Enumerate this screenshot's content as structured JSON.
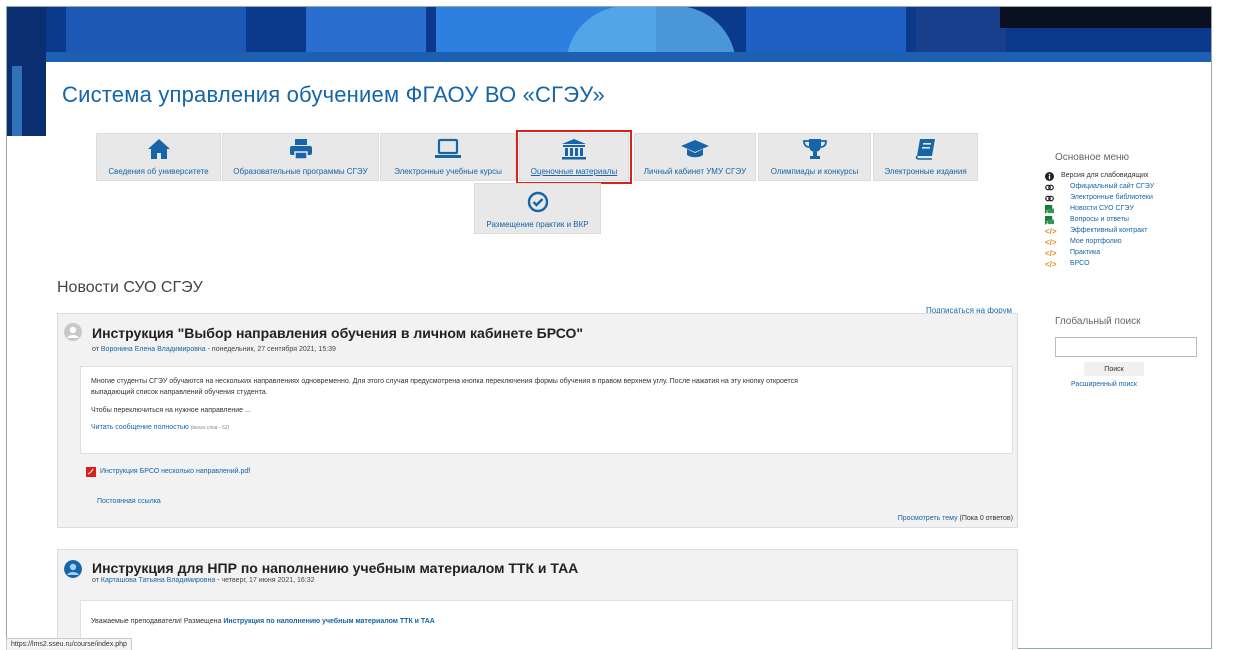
{
  "site_title": "Система управления обучением ФГАОУ ВО «СГЭУ»",
  "nav_tiles": [
    {
      "label": "Сведения об университете",
      "icon": "home-icon"
    },
    {
      "label": "Образовательные программы СГЭУ",
      "icon": "printer-icon"
    },
    {
      "label": "Электронные учебные курсы",
      "icon": "laptop-icon"
    },
    {
      "label": "Оценочные материалы",
      "icon": "university-icon",
      "active": true
    },
    {
      "label": "Личный кабинет УМУ СГЭУ",
      "icon": "graduation-cap-icon"
    },
    {
      "label": "Олимпиады и конкурсы",
      "icon": "trophy-icon"
    },
    {
      "label": "Электронные издания",
      "icon": "book-icon"
    },
    {
      "label": "Размещение практик и ВКР",
      "icon": "check-circle-icon"
    }
  ],
  "news": {
    "heading": "Новости СУО СГЭУ",
    "subscribe_label": "Подписаться на форум",
    "posts": [
      {
        "title": "Инструкция \"Выбор направления обучения в личном кабинете БРСО\"",
        "meta_prefix": "от ",
        "author": "Воронина Елена Владимировна",
        "date": " - понедельник, 27 сентября 2021, 15:39",
        "body_line1": "Многие студенты СГЭУ обучаются на нескольких направлениях одновременно. Для этого случая предусмотрена кнопка переключения формы обучения  в правом верхнем углу. После нажатия на эту кнопку откроется",
        "body_line2": "выпадающий список направлений обучения студента.",
        "body_line3": "Чтобы переключиться на нужное направление ...",
        "read_more": "Читать сообщение полностью",
        "word_count": "(всего слов - 52)",
        "attachment": "Инструкция БРСО несколько направлений.pdf",
        "permalink": "Постоянная ссылка",
        "view_topic": "Просмотреть тему",
        "replies": " (Пока 0 ответов)"
      },
      {
        "title": "Инструкция для НПР по наполнению учебным материалом ТТК и ТАА",
        "meta_prefix": "от ",
        "author": "Карташова Татьяна Владимировна",
        "date": " - четверг, 17 июня 2021, 16:32",
        "body_prefix": "Уважаемые преподаватели! Размещена ",
        "body_link": "Инструкция по наполнению учебным материалом ТТК и ТАА"
      }
    ]
  },
  "sidebar": {
    "menu_title": "Основное меню",
    "menu_items": [
      {
        "label": "Версия для слабовидящих",
        "icon": "info-circle-icon"
      },
      {
        "label": "Официальный сайт СГЭУ",
        "icon": "link-icon"
      },
      {
        "label": "Электронные библиотеки",
        "icon": "link-icon"
      },
      {
        "label": "Новости СУО СГЭУ",
        "icon": "forum-icon"
      },
      {
        "label": "Вопросы и ответы",
        "icon": "forum-icon"
      },
      {
        "label": "Эффективный контракт",
        "icon": "code-icon"
      },
      {
        "label": "Мое портфолио",
        "icon": "code-icon"
      },
      {
        "label": "Практика",
        "icon": "code-icon"
      },
      {
        "label": "БРСО",
        "icon": "code-icon"
      }
    ],
    "search_title": "Глобальный поиск",
    "search_value": "",
    "search_button": "Поиск",
    "advanced_search": "Расширенный поиск"
  },
  "status_bar_url": "https://lms2.sseu.ru/course/index.php",
  "colors": {
    "link": "#1565a8",
    "header_blue": "#0b3a8c",
    "highlight": "#d9201b",
    "tile_bg": "#e8e8e8"
  }
}
